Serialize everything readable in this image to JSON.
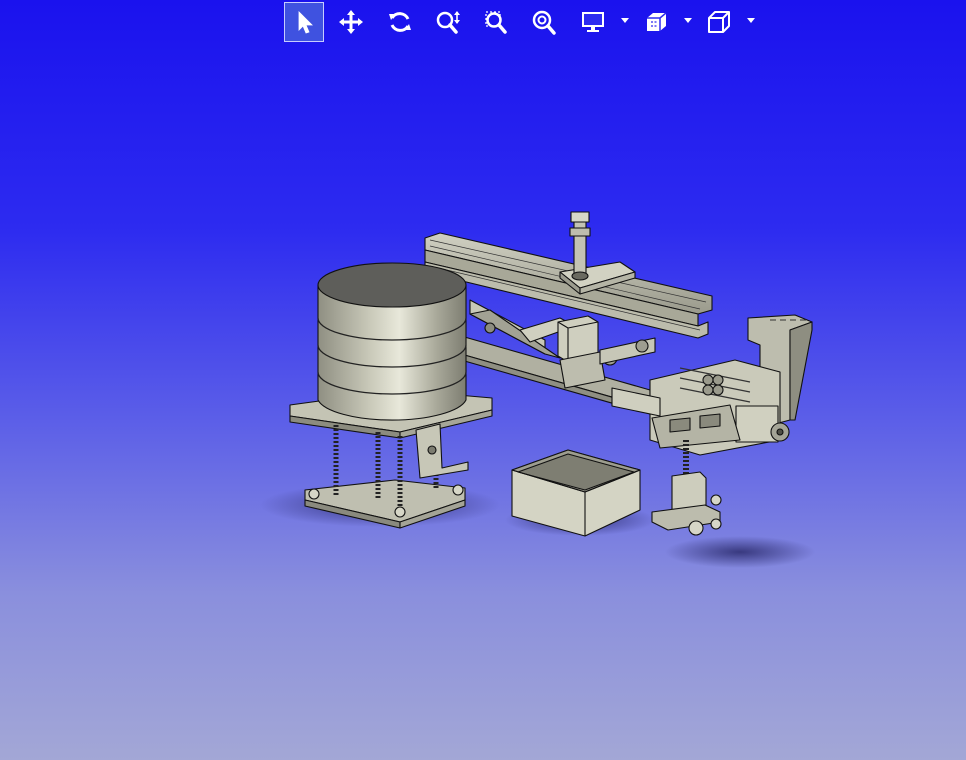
{
  "toolbar": {
    "tools": [
      {
        "name": "select-tool",
        "icon": "cursor-arrow-icon",
        "active": true
      },
      {
        "name": "pan-tool",
        "icon": "move-arrows-icon",
        "active": false
      },
      {
        "name": "rotate-tool",
        "icon": "rotate-icon",
        "active": false
      },
      {
        "name": "zoom-dynamic-tool",
        "icon": "zoom-updown-icon",
        "active": false
      },
      {
        "name": "zoom-window-tool",
        "icon": "zoom-window-icon",
        "active": false
      },
      {
        "name": "zoom-fit-tool",
        "icon": "zoom-fit-icon",
        "active": false
      },
      {
        "name": "display-mode-tool",
        "icon": "monitor-icon",
        "has_dropdown": true
      },
      {
        "name": "section-view-tool",
        "icon": "section-cube-icon",
        "has_dropdown": true
      },
      {
        "name": "view-orientation-tool",
        "icon": "cube-icon",
        "has_dropdown": true
      }
    ],
    "colors": {
      "icon": "#ffffff",
      "active_bg": "#3f52e0",
      "active_border": "#c7ccff"
    }
  },
  "viewport": {
    "background_top": "#1a12ee",
    "background_bottom": "#a3a7d6",
    "model_color": "#b4b4a4",
    "shadow_color": "#3a3a8a"
  }
}
